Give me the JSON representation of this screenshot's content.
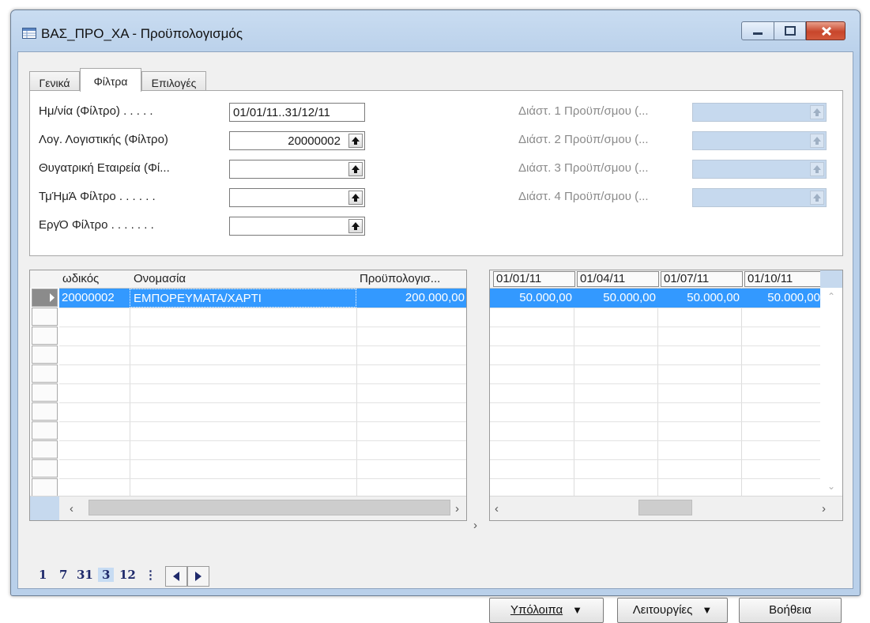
{
  "window": {
    "title": "ΒΑΣ_ΠΡΟ_ΧΑ - Προϋπολογισμός"
  },
  "tabs": [
    {
      "label": "Γενικά",
      "active": false
    },
    {
      "label": "Φίλτρα",
      "active": true
    },
    {
      "label": "Επιλογές",
      "active": false
    }
  ],
  "filters": {
    "left": [
      {
        "label": "Ημ/νία (Φίλτρο) . . . . .",
        "value": "01/01/11..31/12/11"
      },
      {
        "label": "Λογ. Λογιστικής (Φίλτρο)",
        "value": "20000002"
      },
      {
        "label": "Θυγατρική Εταιρεία (Φί...",
        "value": ""
      },
      {
        "label": "ΤμΉμΆ Φίλτρο . . . . . .",
        "value": ""
      },
      {
        "label": "ΕργΌ Φίλτρο . . . . . . .",
        "value": ""
      }
    ],
    "right": [
      {
        "label": "Διάστ. 1 Προϋπ/σμου (...",
        "value": ""
      },
      {
        "label": "Διάστ. 2 Προϋπ/σμου (...",
        "value": ""
      },
      {
        "label": "Διάστ. 3 Προϋπ/σμου (...",
        "value": ""
      },
      {
        "label": "Διάστ. 4 Προϋπ/σμου (...",
        "value": ""
      }
    ]
  },
  "grid_left": {
    "columns": [
      "ωδικός",
      "Ονομασία",
      "Προϋπολογισ..."
    ],
    "rows": [
      {
        "code": "20000002",
        "name": "ΕΜΠΟΡΕΥΜΑΤΑ/ΧΑΡΤΙ",
        "budget": "200.000,00"
      }
    ]
  },
  "grid_right": {
    "columns": [
      "01/01/11",
      "01/04/11",
      "01/07/11",
      "01/10/11"
    ],
    "rows": [
      {
        "values": [
          "50.000,00",
          "50.000,00",
          "50.000,00",
          "50.000,00"
        ]
      }
    ]
  },
  "pager": {
    "items": [
      "1",
      "7",
      "31",
      "3",
      "12"
    ],
    "selected": "3",
    "more": "⋮"
  },
  "buttons": {
    "balances": "Υπόλοιπα",
    "functions": "Λειτουργίες",
    "help": "Βοήθεια"
  },
  "colors": {
    "selection": "#3399ff",
    "disabled_field": "#c6d9ee"
  },
  "icons": [
    "table-icon",
    "minimize-icon",
    "maximize-icon",
    "close-icon",
    "lookup-arrow-icon",
    "prev-icon",
    "next-icon",
    "dropdown-icon"
  ]
}
